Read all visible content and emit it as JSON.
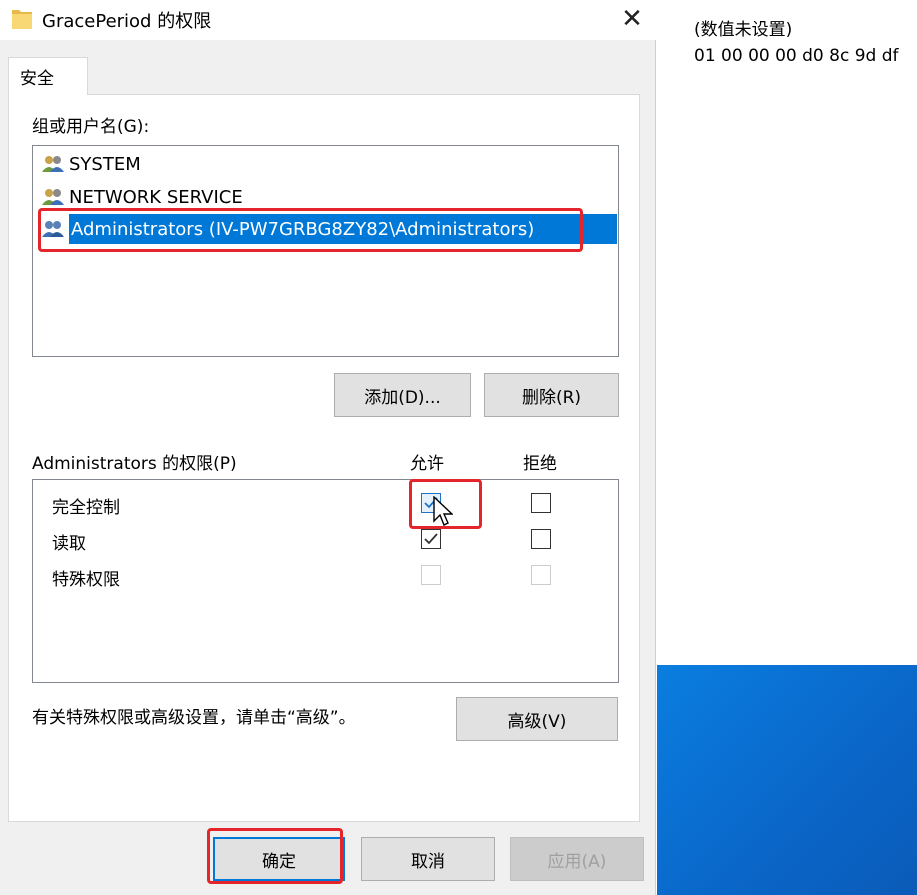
{
  "dialog": {
    "title": "GracePeriod 的权限",
    "close_label": "✕",
    "tab_label": "安全",
    "groups_label": "组或用户名(G):",
    "users": [
      {
        "name": "SYSTEM"
      },
      {
        "name": "NETWORK SERVICE"
      },
      {
        "name": "Administrators (IV-PW7GRBG8ZY82\\Administrators)"
      }
    ],
    "add_button": "添加(D)...",
    "remove_button": "删除(R)",
    "permissions_label": "Administrators 的权限(P)",
    "allow_header": "允许",
    "deny_header": "拒绝",
    "permissions": [
      {
        "name": "完全控制",
        "allow": true,
        "deny": false
      },
      {
        "name": "读取",
        "allow": true,
        "deny": false
      },
      {
        "name": "特殊权限",
        "allow": false,
        "deny": false
      }
    ],
    "advanced_hint": "有关特殊权限或高级设置，请单击“高级”。",
    "advanced_button": "高级(V)",
    "ok_button": "确定",
    "cancel_button": "取消",
    "apply_button": "应用(A)"
  },
  "background": {
    "value_not_set": "(数值未设置)",
    "hex_value": "01 00 00 00 d0 8c 9d df"
  },
  "colors": {
    "selection": "#0078d7",
    "highlight_box": "#e4262c",
    "checkbox_check": "#1e73c8"
  }
}
